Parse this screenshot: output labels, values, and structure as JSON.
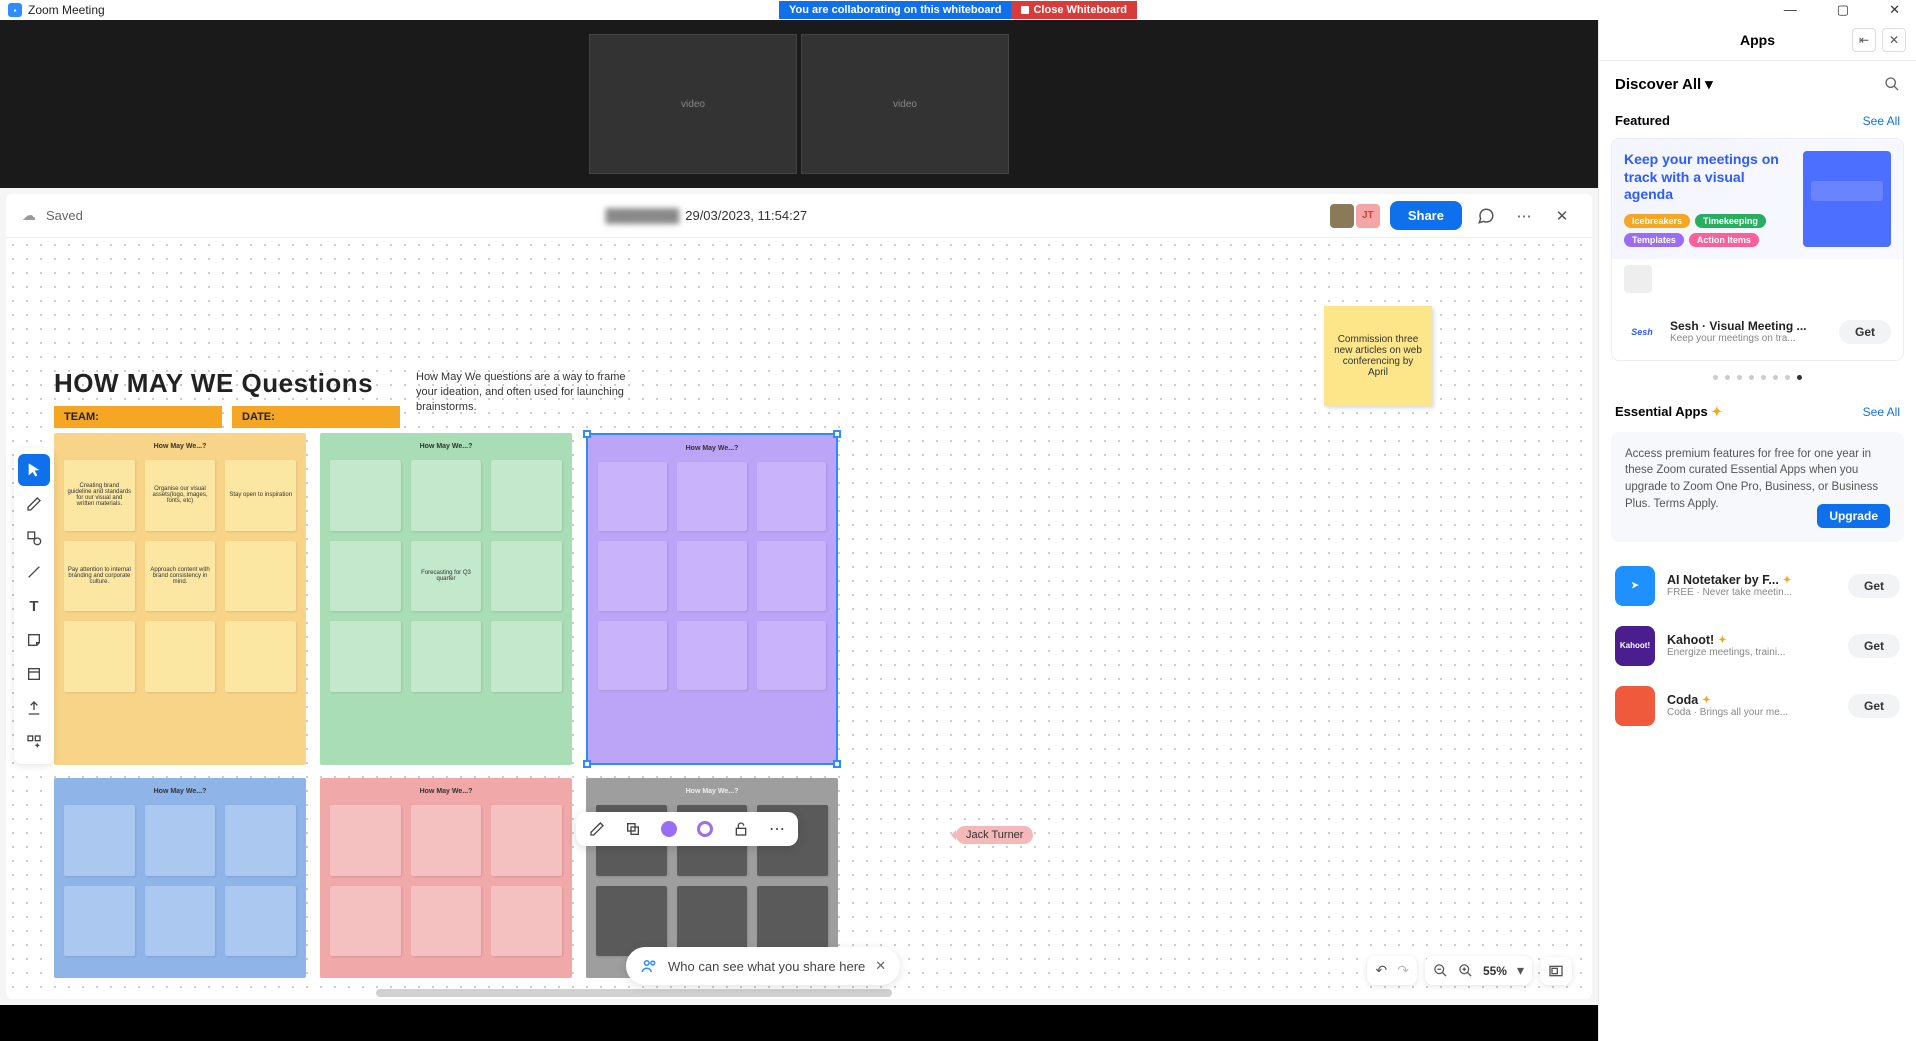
{
  "window": {
    "title": "Zoom Meeting"
  },
  "banners": {
    "collab": "You are collaborating on this whiteboard",
    "close": "Close Whiteboard"
  },
  "whiteboard": {
    "saved_label": "Saved",
    "doc_blur": "████████",
    "doc_date": "29/03/2023, 11:54:27",
    "avatar_initials": "JT",
    "share_label": "Share",
    "zoom_pct": "55%",
    "privacy_text": "Who can see what you share here",
    "cursor_user": "Jack Turner",
    "hmw_title": "HOW MAY WE Questions",
    "team_label": "TEAM:",
    "date_label": "DATE:",
    "hmw_desc": "How May We questions are a way to frame your ideation, and often used for launching brainstorms.",
    "sticky_text": "Commission three new articles on web conferencing by April",
    "panel_head": "How May We...?",
    "yellow_cells": [
      "Creating brand guideline and standards for our visual and written materials.",
      "Organise our visual assets(logo, images, fonts, etc)",
      "Stay open to inspiration",
      "Pay attention to internal branding and corporate culture.",
      "Approach content with brand consistency in mind.",
      "",
      "",
      "",
      ""
    ],
    "green_cells": [
      "",
      "",
      "",
      "",
      "Forecasting for Q3 quarter",
      "",
      "",
      "",
      ""
    ]
  },
  "apps": {
    "panel_title": "Apps",
    "discover_title": "Discover All",
    "featured_label": "Featured",
    "see_all": "See All",
    "feat_hero_title": "Keep your meetings on track with a visual agenda",
    "tags": {
      "ice": "Icebreakers",
      "time": "Timekeeping",
      "tmpl": "Templates",
      "act": "Action Items"
    },
    "feat_app": {
      "icon": "Sesh",
      "name": "Sesh · Visual Meeting ...",
      "sub": "Keep your meetings on tra..."
    },
    "get_label": "Get",
    "essential_label": "Essential Apps",
    "essential_text": "Access premium features for free for one year in these Zoom curated Essential Apps when you upgrade to Zoom One Pro, Business, or Business Plus. Terms Apply.",
    "upgrade_label": "Upgrade",
    "list": [
      {
        "name": "AI Notetaker by F...",
        "sub": "FREE · Never take meetin...",
        "color": "#1E90FF",
        "abbr": "➤"
      },
      {
        "name": "Kahoot!",
        "sub": "Energize meetings, traini...",
        "color": "#4B1E8F",
        "abbr": "Kahoot!"
      },
      {
        "name": "Coda",
        "sub": "Coda · Brings all your me...",
        "color": "#F05A3C",
        "abbr": ""
      }
    ]
  }
}
